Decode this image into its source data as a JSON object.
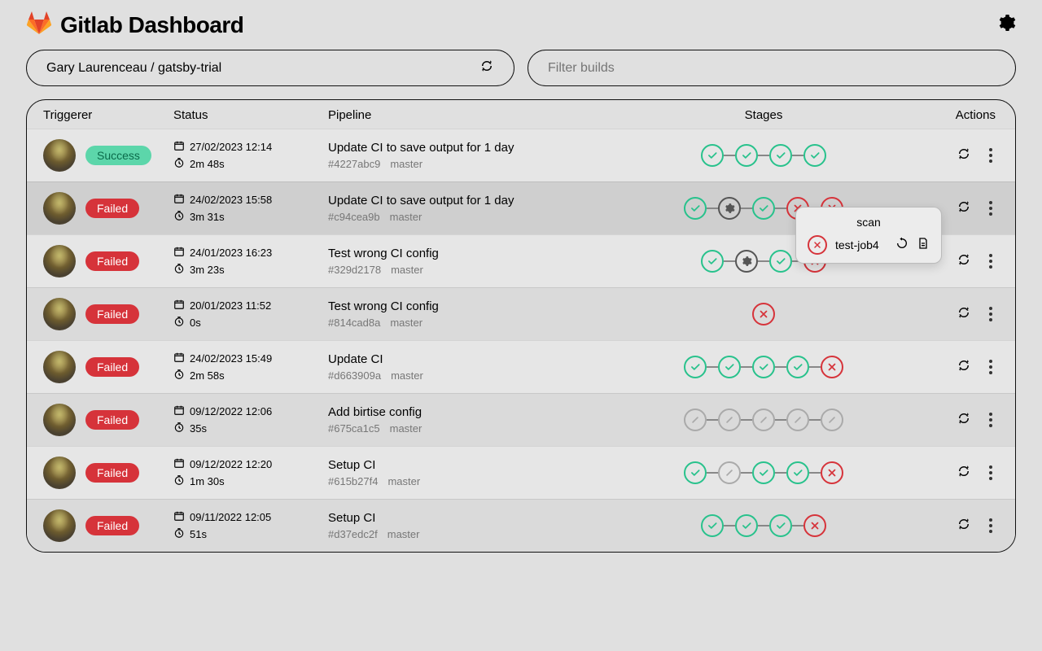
{
  "header": {
    "title": "Gitlab Dashboard"
  },
  "filters": {
    "project": "Gary Laurenceau / gatsby-trial",
    "search_placeholder": "Filter builds"
  },
  "columns": {
    "triggerer": "Triggerer",
    "status": "Status",
    "pipeline": "Pipeline",
    "stages": "Stages",
    "actions": "Actions"
  },
  "status_labels": {
    "success": "Success",
    "failed": "Failed"
  },
  "popover": {
    "title": "scan",
    "job": "test-job4",
    "status": "fail"
  },
  "rows": [
    {
      "status": "success",
      "date": "27/02/2023 12:14",
      "duration": "2m 48s",
      "title": "Update CI to save output for 1 day",
      "hash": "#4227abc9",
      "branch": "master",
      "stages": [
        "pass",
        "pass",
        "pass",
        "pass"
      ],
      "highlight": false,
      "popover": false
    },
    {
      "status": "failed",
      "date": "24/02/2023 15:58",
      "duration": "3m 31s",
      "title": "Update CI to save output for 1 day",
      "hash": "#c94cea9b",
      "branch": "master",
      "stages": [
        "pass",
        "running",
        "pass",
        "fail",
        "fail"
      ],
      "highlight": true,
      "popover": true
    },
    {
      "status": "failed",
      "date": "24/01/2023 16:23",
      "duration": "3m 23s",
      "title": "Test wrong CI config",
      "hash": "#329d2178",
      "branch": "master",
      "stages": [
        "pass",
        "running",
        "pass",
        "fail"
      ],
      "highlight": false,
      "popover": false
    },
    {
      "status": "failed",
      "date": "20/01/2023 11:52",
      "duration": "0s",
      "title": "Test wrong CI config",
      "hash": "#814cad8a",
      "branch": "master",
      "stages": [
        "fail"
      ],
      "highlight": false,
      "popover": false
    },
    {
      "status": "failed",
      "date": "24/02/2023 15:49",
      "duration": "2m 58s",
      "title": "Update CI",
      "hash": "#d663909a",
      "branch": "master",
      "stages": [
        "pass",
        "pass",
        "pass",
        "pass",
        "fail"
      ],
      "highlight": false,
      "popover": false
    },
    {
      "status": "failed",
      "date": "09/12/2022 12:06",
      "duration": "35s",
      "title": "Add birtise config",
      "hash": "#675ca1c5",
      "branch": "master",
      "stages": [
        "skipped",
        "skipped",
        "skipped",
        "skipped",
        "skipped"
      ],
      "highlight": false,
      "popover": false
    },
    {
      "status": "failed",
      "date": "09/12/2022 12:20",
      "duration": "1m 30s",
      "title": "Setup CI",
      "hash": "#615b27f4",
      "branch": "master",
      "stages": [
        "pass",
        "skipped",
        "pass",
        "pass",
        "fail"
      ],
      "highlight": false,
      "popover": false
    },
    {
      "status": "failed",
      "date": "09/11/2022 12:05",
      "duration": "51s",
      "title": "Setup CI",
      "hash": "#d37edc2f",
      "branch": "master",
      "stages": [
        "pass",
        "pass",
        "pass",
        "fail"
      ],
      "highlight": false,
      "popover": false
    }
  ]
}
